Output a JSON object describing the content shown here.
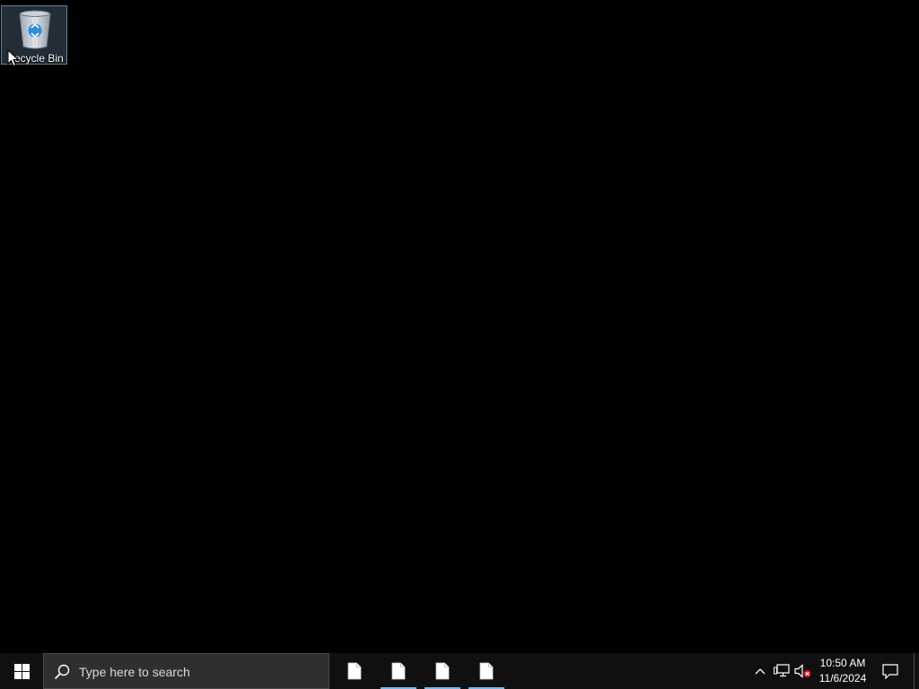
{
  "desktop": {
    "icons": [
      {
        "label": "Recycle Bin",
        "icon": "recycle-bin-icon"
      }
    ]
  },
  "taskbar": {
    "start_icon": "windows-logo-icon",
    "search": {
      "placeholder": "Type here to search",
      "icon": "search-icon"
    },
    "task_buttons": [
      {
        "icon": "document-icon",
        "running": false
      },
      {
        "icon": "document-icon",
        "running": true
      },
      {
        "icon": "document-icon",
        "running": true
      },
      {
        "icon": "document-icon",
        "running": true
      }
    ],
    "tray": {
      "icons": [
        "chevron-up-icon",
        "network-icon",
        "volume-muted-icon"
      ],
      "time": "10:50 AM",
      "date": "11/6/2024",
      "notification_icon": "action-center-icon"
    }
  },
  "colors": {
    "desktop_background": "#000000",
    "taskbar_background": "#101010",
    "search_background": "#2f2f2f",
    "running_indicator": "#76b9ed",
    "windows_logo": "#ffffff",
    "muted_badge": "#e81123"
  }
}
